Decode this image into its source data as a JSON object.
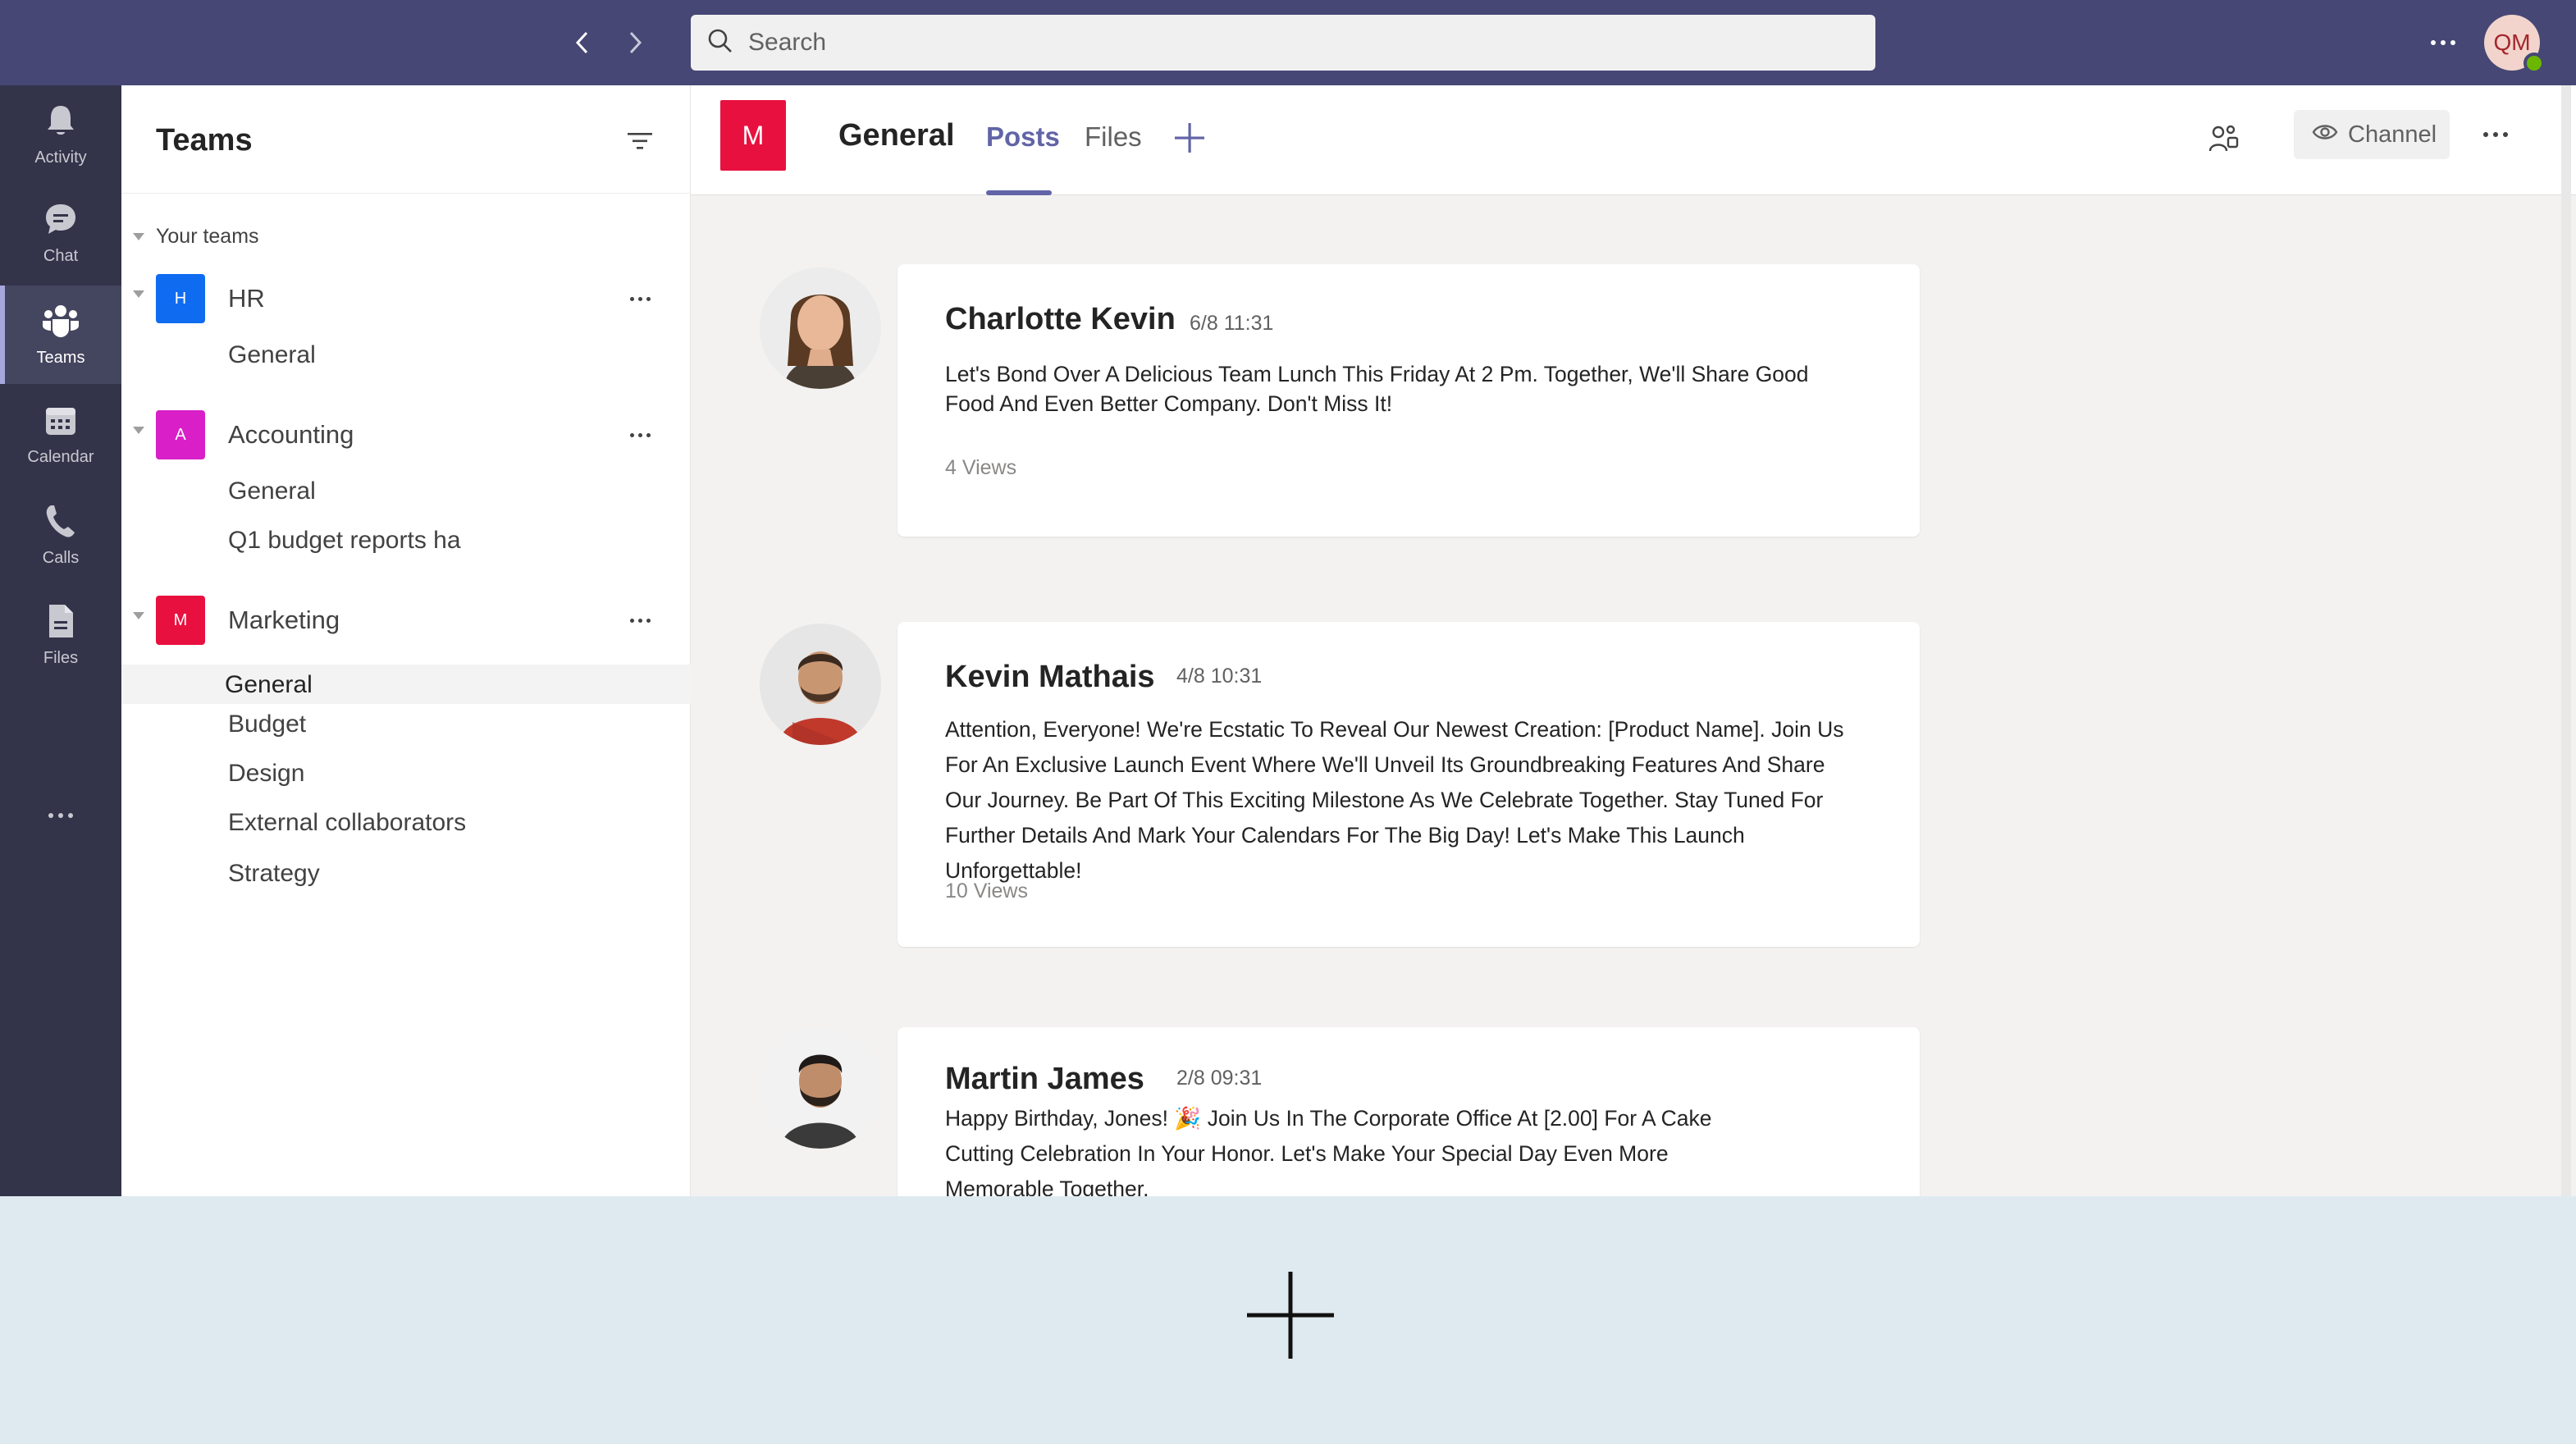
{
  "search": {
    "placeholder": "Search"
  },
  "user": {
    "initials": "QM"
  },
  "rail": {
    "items": [
      {
        "label": "Activity",
        "icon": "bell-icon"
      },
      {
        "label": "Chat",
        "icon": "chat-icon"
      },
      {
        "label": "Teams",
        "icon": "teams-icon",
        "active": true
      },
      {
        "label": "Calendar",
        "icon": "calendar-icon"
      },
      {
        "label": "Calls",
        "icon": "phone-icon"
      },
      {
        "label": "Files",
        "icon": "file-icon"
      }
    ]
  },
  "teams_panel": {
    "title": "Teams",
    "section_label": "Your teams",
    "teams": [
      {
        "initial": "H",
        "name": "HR",
        "color": "#0f6cf0",
        "channels": [
          "General"
        ]
      },
      {
        "initial": "A",
        "name": "Accounting",
        "color": "#d91fc8",
        "channels": [
          "General",
          "Q1 budget reports ha"
        ]
      },
      {
        "initial": "M",
        "name": "Marketing",
        "color": "#e8103f",
        "channels": [
          "General",
          "Budget",
          "Design",
          "External collaborators",
          "Strategy"
        ]
      }
    ]
  },
  "channel_header": {
    "badge": "M",
    "title": "General",
    "tabs": [
      "Posts",
      "Files"
    ],
    "active_tab": "Posts",
    "channel_button": "Channel"
  },
  "posts": [
    {
      "author": "Charlotte Kevin",
      "time": "6/8 11:31",
      "body": "Let's Bond Over A Delicious Team Lunch This Friday At 2 Pm. Together, We'll Share Good Food And Even Better Company. Don't Miss It!",
      "views": "4 Views"
    },
    {
      "author": "Kevin Mathais",
      "time": "4/8 10:31",
      "body": "Attention, Everyone! We're Ecstatic To Reveal Our Newest Creation: [Product Name]. Join Us For An Exclusive Launch Event Where We'll Unveil Its Groundbreaking Features And Share Our Journey. Be Part Of This Exciting Milestone As We Celebrate Together. Stay Tuned For Further Details And Mark Your Calendars For The Big Day! Let's Make This Launch Unforgettable!",
      "views": "10 Views"
    },
    {
      "author": "Martin James",
      "time": "2/8 09:31",
      "body": "Happy Birthday, Jones! 🎉 Join Us In The Corporate Office At [2.00] For A Cake Cutting Celebration In Your Honor. Let's Make Your Special Day Even More Memorable Together."
    }
  ],
  "colors": {
    "topbar": "#464775",
    "rail": "#33344a",
    "accent": "#6264a7"
  }
}
